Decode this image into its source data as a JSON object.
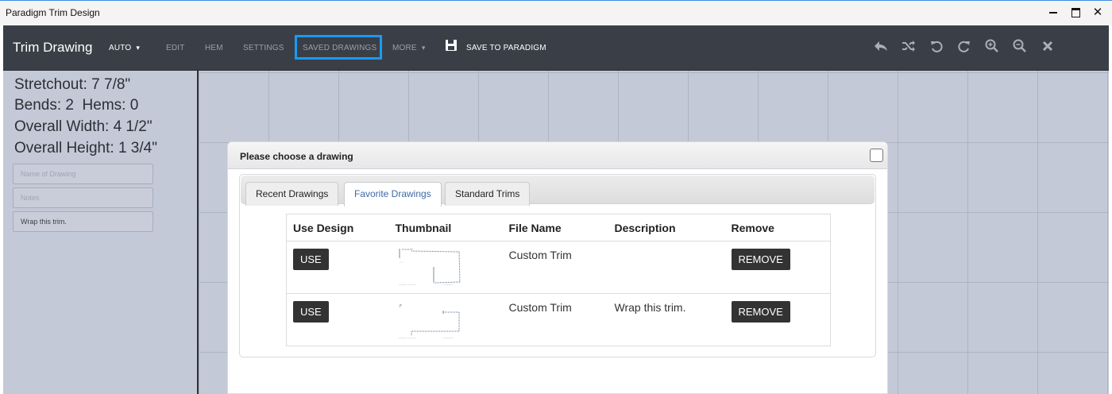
{
  "window": {
    "title": "Paradigm Trim Design",
    "controls": [
      "minimize",
      "maximize",
      "close"
    ]
  },
  "toolbar": {
    "brand": "Trim Drawing",
    "auto_label": "AUTO",
    "edit_label": "EDIT",
    "hem_label": "HEM",
    "settings_label": "SETTINGS",
    "saved_label": "SAVED DRAWINGS",
    "more_label": "MORE",
    "save_label": "SAVE TO PARADIGM",
    "highlight_color": "#1a9af2",
    "icons": [
      "reply-icon",
      "shuffle-icon",
      "undo-icon",
      "redo-icon",
      "zoom-in-icon",
      "zoom-out-icon",
      "close-icon"
    ]
  },
  "left": {
    "stretchout": "Stretchout: 7 7/8\"",
    "bends_hems": "Bends: 2  Hems: 0",
    "width": "Overall Width: 4 1/2\"",
    "height": "Overall Height: 1 3/4\"",
    "name_placeholder": "Name of Drawing",
    "notes_placeholder": "Notes",
    "wrap_value": "Wrap this trim."
  },
  "modal": {
    "title": "Please choose a drawing",
    "tabs": [
      {
        "label": "Recent Drawings"
      },
      {
        "label": "Favorite Drawings",
        "active": true
      },
      {
        "label": "Standard Trims"
      }
    ],
    "columns": [
      "Use Design",
      "Thumbnail",
      "File Name",
      "Description",
      "Remove"
    ],
    "rows": [
      {
        "use": "USE",
        "file": "Custom Trim",
        "description": "",
        "remove": "REMOVE"
      },
      {
        "use": "USE",
        "file": "Custom Trim",
        "description": "Wrap this trim.",
        "remove": "REMOVE"
      }
    ]
  }
}
